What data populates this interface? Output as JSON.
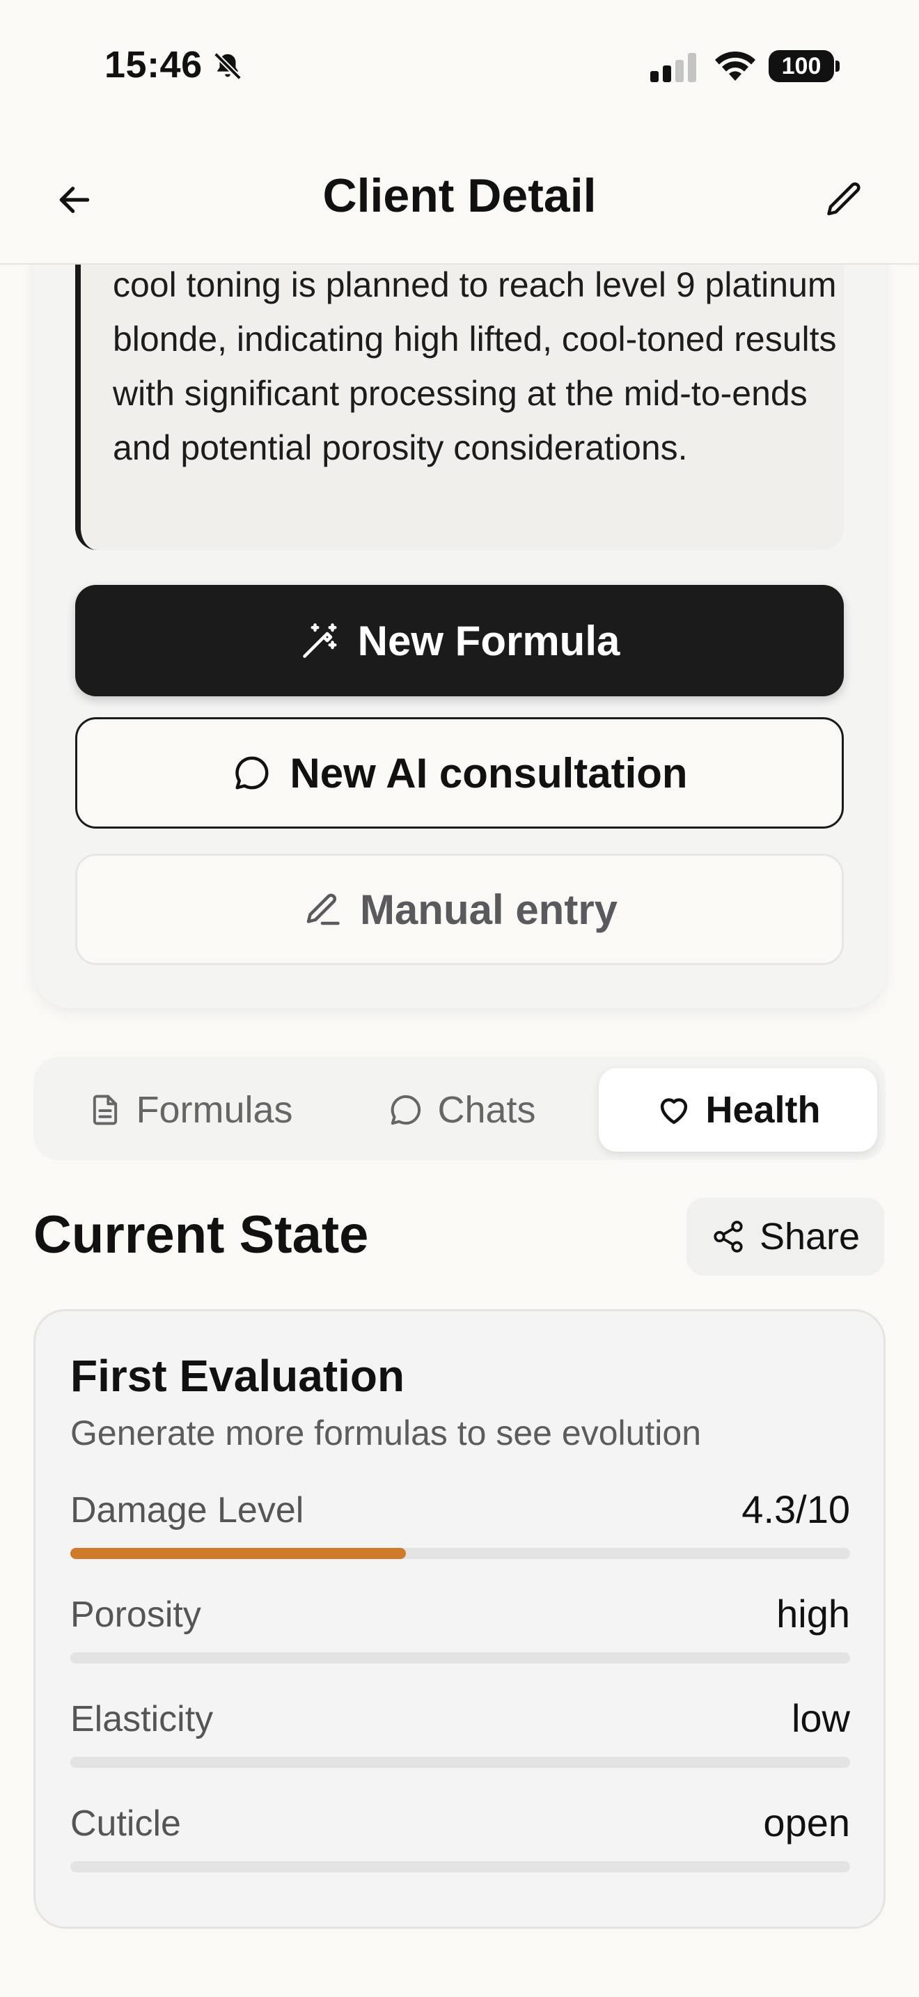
{
  "status_bar": {
    "time": "15:46",
    "battery": "100",
    "icons": [
      "bell-slash-icon",
      "signal-icon",
      "wifi-icon",
      "battery-icon"
    ]
  },
  "header": {
    "title": "Client Detail",
    "back_icon": "arrow-left-icon",
    "edit_icon": "pencil-icon"
  },
  "summary": {
    "note": "cool toning is planned to reach level 9 platinum blonde, indicating high lifted, cool-toned results with significant processing at the mid-to-ends and potential porosity considerations."
  },
  "actions": {
    "new_formula": "New Formula",
    "new_ai_consultation": "New AI consultation",
    "manual_entry": "Manual entry"
  },
  "tabs": [
    {
      "label": "Formulas",
      "icon": "document-icon",
      "active": false
    },
    {
      "label": "Chats",
      "icon": "chat-bubble-icon",
      "active": false
    },
    {
      "label": "Health",
      "icon": "heart-icon",
      "active": true
    }
  ],
  "current_state": {
    "title": "Current State",
    "share_label": "Share",
    "card": {
      "title": "First Evaluation",
      "subtitle": "Generate more formulas to see evolution",
      "metrics": [
        {
          "label": "Damage Level",
          "value": "4.3/10",
          "progress": 0.43,
          "color": "#d07a2c"
        },
        {
          "label": "Porosity",
          "value": "high",
          "progress": 0,
          "color": "#d07a2c"
        },
        {
          "label": "Elasticity",
          "value": "low",
          "progress": 0,
          "color": "#d07a2c"
        },
        {
          "label": "Cuticle",
          "value": "open",
          "progress": 0,
          "color": "#d07a2c"
        }
      ]
    }
  },
  "colors": {
    "background": "#faf9f6",
    "primary_button": "#1b1b1b",
    "accent": "#d07a2c"
  }
}
